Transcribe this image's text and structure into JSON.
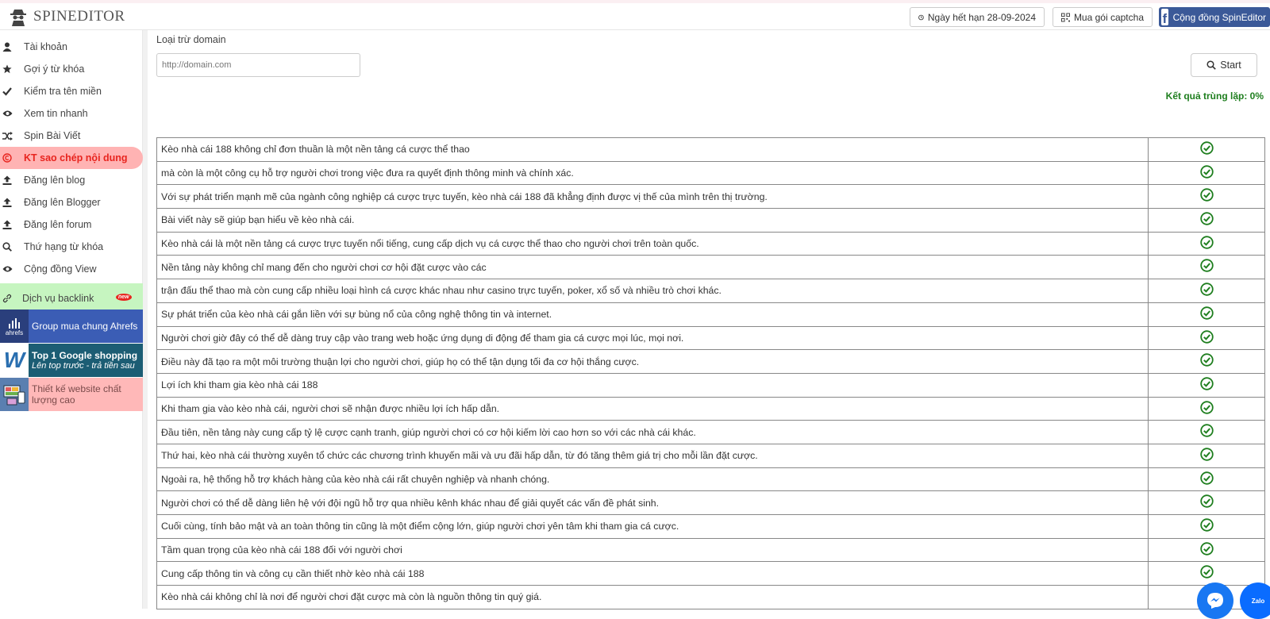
{
  "app": {
    "name": "SPINEDITOR"
  },
  "header": {
    "expiry_label": "Ngày hết hạn 28-09-2024",
    "captcha_label": "Mua gói captcha",
    "community_label": "Cộng đồng SpinEditor",
    "fb_letter": "f"
  },
  "sidebar": {
    "items": [
      {
        "label": "Tài khoản",
        "icon": "user-icon"
      },
      {
        "label": "Gợi ý từ khóa",
        "icon": "star-icon"
      },
      {
        "label": "Kiểm tra tên miền",
        "icon": "check-icon"
      },
      {
        "label": "Xem tin nhanh",
        "icon": "eye-icon"
      },
      {
        "label": "Spin Bài Viết",
        "icon": "shuffle-icon"
      },
      {
        "label": "KT sao chép nội dung",
        "icon": "copyright-icon",
        "active": true
      },
      {
        "label": "Đăng lên blog",
        "icon": "upload-icon"
      },
      {
        "label": "Đăng lên Blogger",
        "icon": "upload-icon"
      },
      {
        "label": "Đăng lên forum",
        "icon": "upload-icon"
      },
      {
        "label": "Thứ hạng từ khóa",
        "icon": "search-icon"
      },
      {
        "label": "Cộng đồng View",
        "icon": "eye-icon"
      }
    ],
    "backlink": {
      "label": "Dịch vụ backlink",
      "badge": "new",
      "icon": "link-icon"
    },
    "promos": {
      "ahrefs": {
        "label": "Group mua chung Ahrefs",
        "thumb_text": "ahrefs"
      },
      "google": {
        "line1": "Top 1 Google shopping",
        "line2": "Lên top trước - trả tiền sau",
        "thumb_text": "W"
      },
      "web": {
        "label": "Thiết kế website chất lượng cao"
      }
    }
  },
  "main": {
    "exclude_label": "Loại trừ domain",
    "exclude_placeholder": "http://domain.com",
    "start_label": "Start",
    "result_text": "Kết quả trùng lặp: 0%",
    "rows": [
      "Kèo nhà cái 188 không chỉ đơn thuần là một nền tảng cá cược thể thao",
      "mà còn là một công cụ hỗ trợ người chơi trong việc đưa ra quyết định thông minh và chính xác.",
      "Với sự phát triển mạnh mẽ của ngành công nghiệp cá cược trực tuyến, kèo nhà cái 188 đã khẳng định được vị thế của mình trên thị trường.",
      "Bài viết này sẽ giúp bạn hiểu về kèo nhà cái.",
      "Kèo nhà cái là một nền tảng cá cược trực tuyến nổi tiếng, cung cấp dịch vụ cá cược thể thao cho người chơi trên toàn quốc.",
      "Nền tảng này không chỉ mang đến cho người chơi cơ hội đặt cược vào các",
      "trận đấu thể thao mà còn cung cấp nhiều loại hình cá cược khác nhau như casino trực tuyến, poker, xổ số và nhiều trò chơi khác.",
      "Sự phát triển của kèo nhà cái gắn liền với sự bùng nổ của công nghệ thông tin và internet.",
      "Người chơi giờ đây có thể dễ dàng truy cập vào trang web hoặc ứng dụng di động để tham gia cá cược mọi lúc, mọi nơi.",
      "Điều này đã tạo ra một môi trường thuận lợi cho người chơi, giúp họ có thể tận dụng tối đa cơ hội thắng cược.",
      "Lợi ích khi tham gia kèo nhà cái 188",
      "Khi tham gia vào kèo nhà cái, người chơi sẽ nhận được nhiều lợi ích hấp dẫn.",
      "Đầu tiên, nền tảng này cung cấp tỷ lệ cược cạnh tranh, giúp người chơi có cơ hội kiếm lời cao hơn so với các nhà cái khác.",
      "Thứ hai, kèo nhà cái thường xuyên tổ chức các chương trình khuyến mãi và ưu đãi hấp dẫn, từ đó tăng thêm giá trị cho mỗi lần đặt cược.",
      "Ngoài ra, hệ thống hỗ trợ khách hàng của kèo nhà cái rất chuyên nghiệp và nhanh chóng.",
      "Người chơi có thể dễ dàng liên hệ với đội ngũ hỗ trợ qua nhiều kênh khác nhau để giải quyết các vấn đề phát sinh.",
      "Cuối cùng, tính bảo mật và an toàn thông tin cũng là một điểm cộng lớn, giúp người chơi yên tâm khi tham gia cá cược.",
      "Tầm quan trọng của kèo nhà cái 188 đối với người chơi",
      "Cung cấp thông tin và công cụ cần thiết nhờ kèo nhà cái 188",
      "Kèo nhà cái không chỉ là nơi để người chơi đặt cược mà còn là nguồn thông tin quý giá."
    ],
    "status_icon": "check-circle-icon"
  },
  "floating": {
    "zalo_label": "Zalo",
    "messenger_icon": "messenger-icon"
  },
  "colors": {
    "accent_green": "#1e7e1e",
    "active_red": "#e8251f",
    "fb_blue": "#3b5998"
  }
}
